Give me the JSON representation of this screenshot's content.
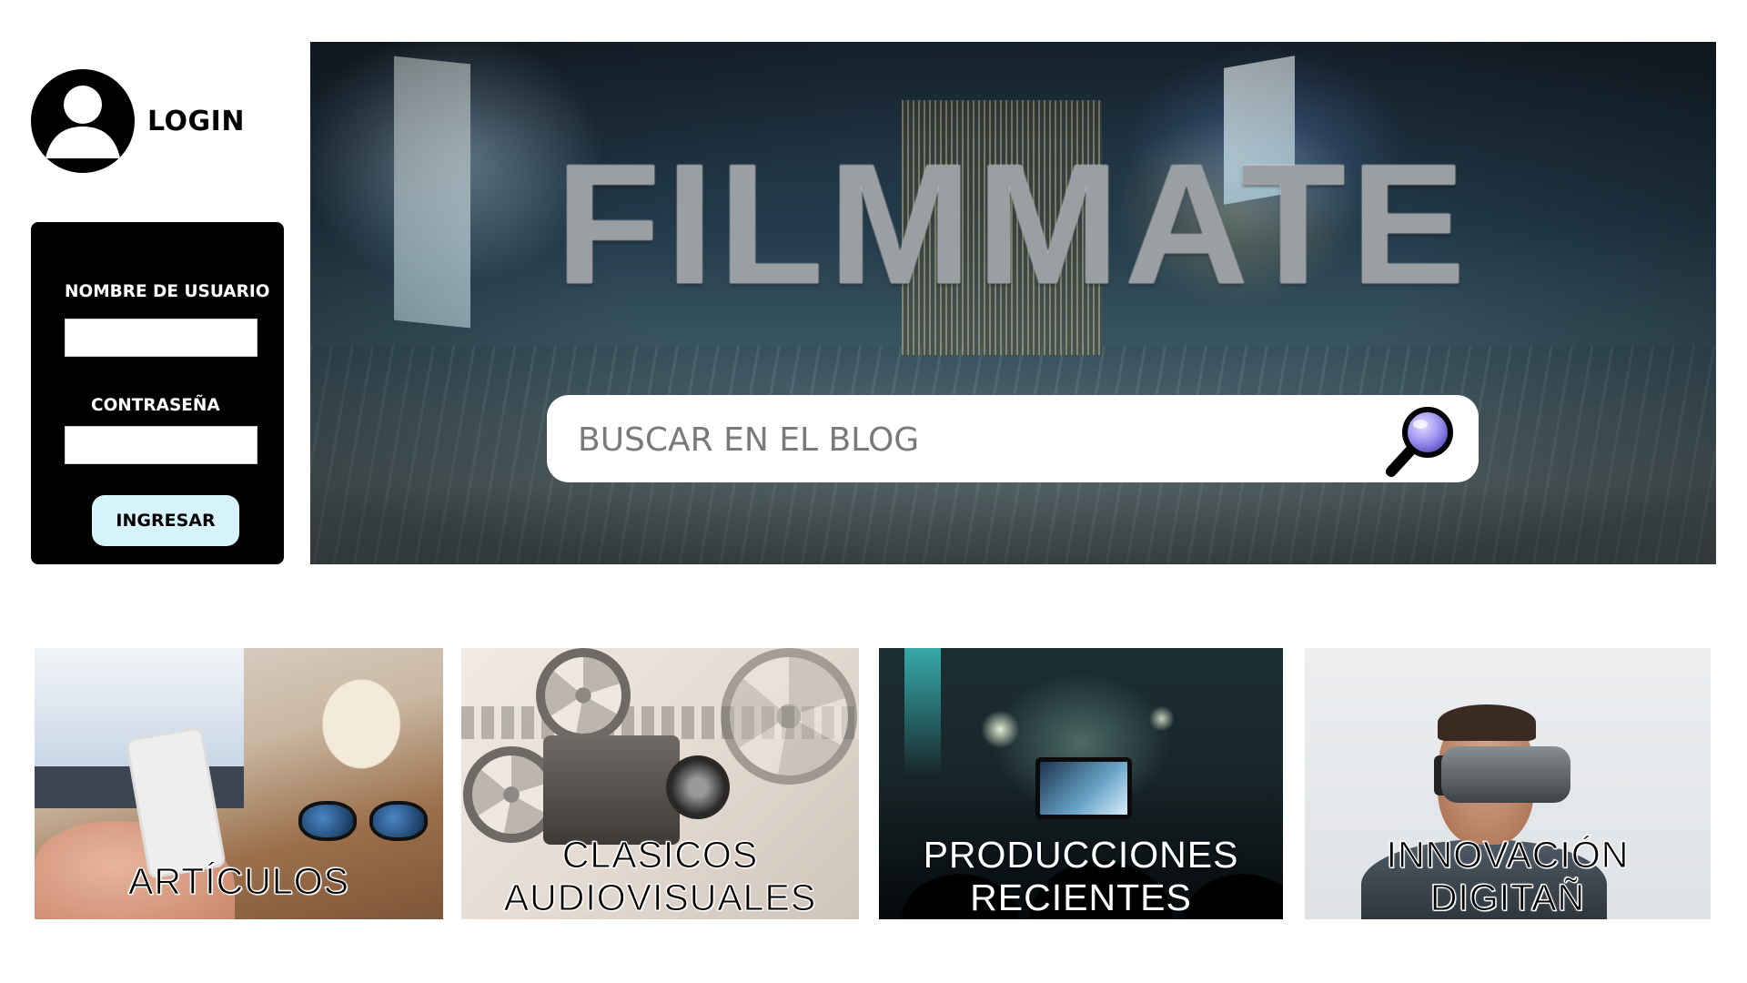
{
  "login": {
    "title": "LOGIN",
    "username_label": "NOMBRE DE USUARIO",
    "username_value": "",
    "password_label": "CONTRASEÑA",
    "password_value": "",
    "submit_label": "INGRESAR"
  },
  "hero": {
    "brand": "FILMMATE",
    "search_placeholder": "BUSCAR EN EL BLOG",
    "search_icon": "magnifier-icon"
  },
  "categories": [
    {
      "label_line1": "ARTÍCULOS",
      "label_line2": ""
    },
    {
      "label_line1": "CLASICOS",
      "label_line2": "AUDIOVISUALES"
    },
    {
      "label_line1": "PRODUCCIONES",
      "label_line2": "RECIENTES"
    },
    {
      "label_line1": "INNOVACIÓN",
      "label_line2": "DIGITAÑ"
    }
  ],
  "colors": {
    "form_background": "#000000",
    "button_background": "#d7f3fb",
    "brand_text": "#9c9fa1"
  }
}
